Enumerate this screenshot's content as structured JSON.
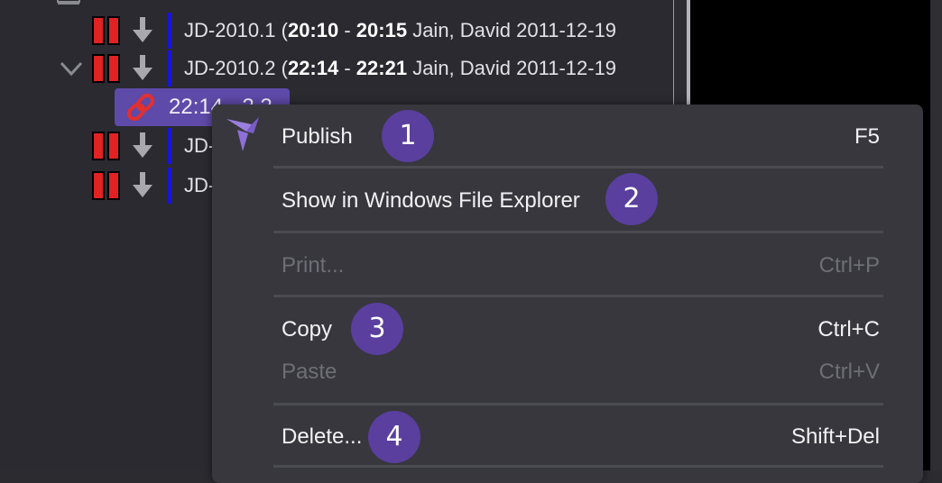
{
  "tree": {
    "rows": [
      {
        "prefix": "JD-2010.1 (",
        "start": "20:10",
        "dash": " - ",
        "end": "20:15",
        "rest": " Jain, David 2011-12-19"
      },
      {
        "prefix": "JD-2010.2 (",
        "start": "22:14",
        "dash": " - ",
        "end": "22:21",
        "rest": " Jain, David 2011-12-19"
      },
      {
        "text": "JD-"
      },
      {
        "text": "JD-"
      }
    ],
    "link_chip_text": "22:14 - 2.2",
    "icons": {
      "pause": "pause-icon",
      "down": "arrow-down-icon",
      "link": "link-icon",
      "expand": "chevron-down-icon"
    },
    "colors": {
      "pause": "#e22222",
      "row_marker": "#1a14d8",
      "chip": "#5e4aa8"
    }
  },
  "context_menu": {
    "logo_icon": "bird-logo-icon",
    "items": [
      {
        "label": "Publish",
        "shortcut": "F5",
        "badge": "1",
        "enabled": true
      },
      {
        "label": "Show in Windows File Explorer",
        "shortcut": "",
        "badge": "2",
        "enabled": true
      },
      {
        "label": "Print...",
        "shortcut": "Ctrl+P",
        "badge": "",
        "enabled": false
      },
      {
        "label": "Copy",
        "shortcut": "Ctrl+C",
        "badge": "3",
        "enabled": true
      },
      {
        "label": "Paste",
        "shortcut": "Ctrl+V",
        "badge": "",
        "enabled": false
      },
      {
        "label": "Delete...",
        "shortcut": "Shift+Del",
        "badge": "4",
        "enabled": true
      }
    ],
    "colors": {
      "background": "#37373d",
      "badge": "#5a3f9e",
      "disabled_text": "#6e6e76"
    }
  }
}
